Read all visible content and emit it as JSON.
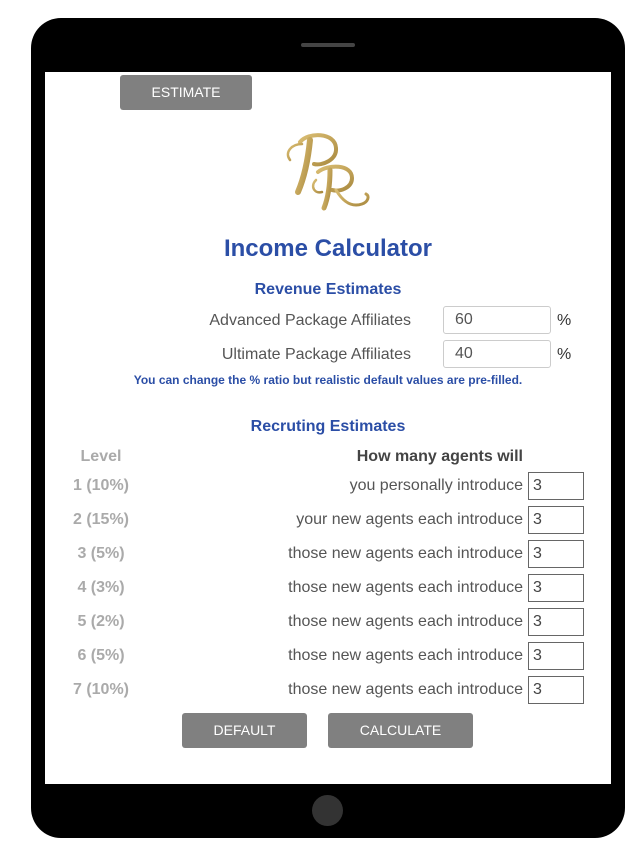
{
  "toolbar": {
    "estimate_label": "ESTIMATE"
  },
  "logo": {
    "monogram": "RR",
    "color": "#c4a55a"
  },
  "title": "Income Calculator",
  "revenue": {
    "heading": "Revenue Estimates",
    "fields": [
      {
        "label": "Advanced Package Affiliates",
        "value": "60",
        "unit": "%"
      },
      {
        "label": "Ultimate Package Affiliates",
        "value": "40",
        "unit": "%"
      }
    ],
    "note": "You can change the % ratio but realistic default values are pre-filled."
  },
  "recruiting": {
    "heading": "Recruting Estimates",
    "level_header": "Level",
    "agents_header": "How many agents will",
    "rows": [
      {
        "level": "1 (10%)",
        "description": "you personally introduce",
        "value": "3"
      },
      {
        "level": "2 (15%)",
        "description": "your new agents each introduce",
        "value": "3"
      },
      {
        "level": "3 (5%)",
        "description": "those new agents each introduce",
        "value": "3"
      },
      {
        "level": "4 (3%)",
        "description": "those new agents each introduce",
        "value": "3"
      },
      {
        "level": "5 (2%)",
        "description": "those new agents each introduce",
        "value": "3"
      },
      {
        "level": "6 (5%)",
        "description": "those new agents each introduce",
        "value": "3"
      },
      {
        "level": "7 (10%)",
        "description": "those new agents each introduce",
        "value": "3"
      }
    ]
  },
  "actions": {
    "default_label": "DEFAULT",
    "calculate_label": "CALCULATE"
  },
  "colors": {
    "accent_blue": "#2b4ea6",
    "button_gray": "#808080",
    "level_gray": "#aaaaaa",
    "device_frame": "#000000"
  }
}
